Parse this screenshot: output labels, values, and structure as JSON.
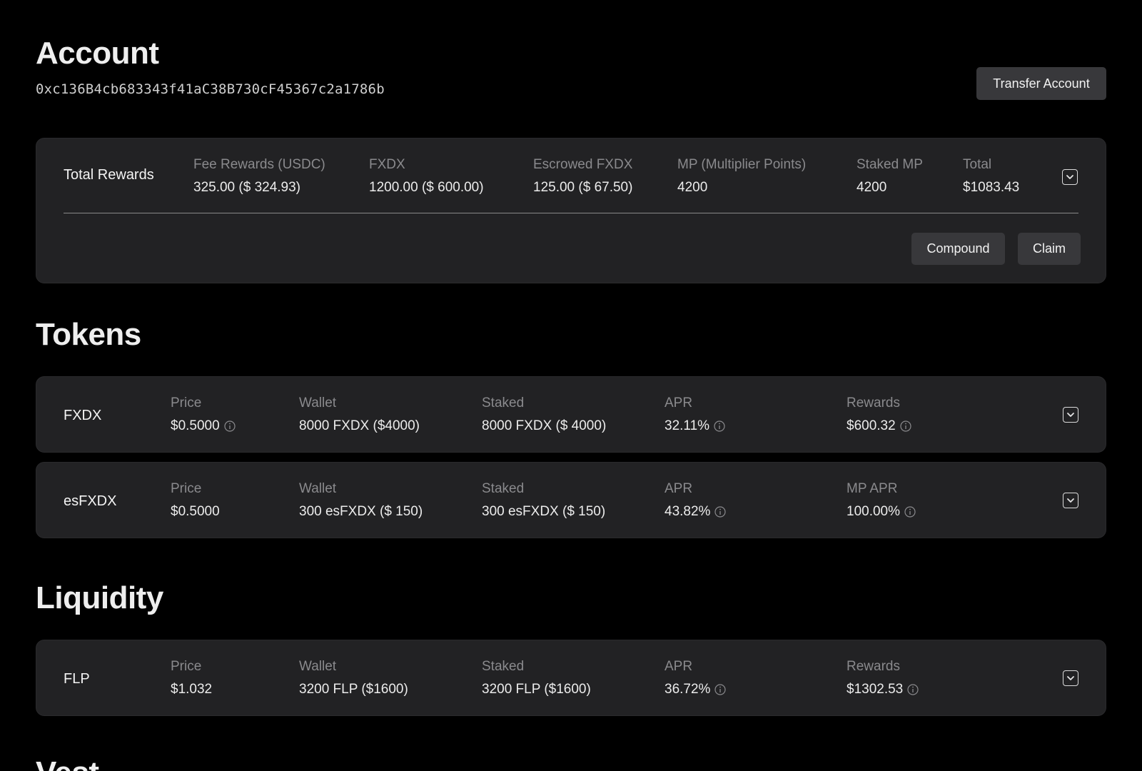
{
  "account": {
    "title": "Account",
    "address": "0xc136B4cb683343f41aC38B730cF45367c2a1786b",
    "transfer_label": "Transfer Account"
  },
  "rewards": {
    "title": "Total Rewards",
    "fee": {
      "label": "Fee Rewards (USDC)",
      "value": "325.00 ($ 324.93)"
    },
    "fxdx": {
      "label": "FXDX",
      "value": "1200.00 ($ 600.00)"
    },
    "escrowed": {
      "label": "Escrowed FXDX",
      "value": "125.00 ($ 67.50)"
    },
    "mp": {
      "label": "MP (Multiplier Points)",
      "value": "4200"
    },
    "staked_mp": {
      "label": "Staked MP",
      "value": "4200"
    },
    "total": {
      "label": "Total",
      "value": "$1083.43"
    },
    "compound_label": "Compound",
    "claim_label": "Claim"
  },
  "tokens": {
    "title": "Tokens",
    "rows": [
      {
        "name": "FXDX",
        "price_label": "Price",
        "price": "$0.5000",
        "wallet_label": "Wallet",
        "wallet": "8000 FXDX ($4000)",
        "staked_label": "Staked",
        "staked": "8000 FXDX ($ 4000)",
        "apr_label": "APR",
        "apr": "32.11%",
        "extra_label": "Rewards",
        "extra": "$600.32"
      },
      {
        "name": "esFXDX",
        "price_label": "Price",
        "price": "$0.5000",
        "wallet_label": "Wallet",
        "wallet": "300 esFXDX ($ 150)",
        "staked_label": "Staked",
        "staked": "300 esFXDX ($ 150)",
        "apr_label": "APR",
        "apr": "43.82%",
        "extra_label": "MP APR",
        "extra": "100.00%"
      }
    ]
  },
  "liquidity": {
    "title": "Liquidity",
    "rows": [
      {
        "name": "FLP",
        "price_label": "Price",
        "price": "$1.032",
        "wallet_label": "Wallet",
        "wallet": "3200 FLP ($1600)",
        "staked_label": "Staked",
        "staked": "3200 FLP ($1600)",
        "apr_label": "APR",
        "apr": "36.72%",
        "extra_label": "Rewards",
        "extra": "$1302.53"
      }
    ]
  },
  "next_section": {
    "title": "Vest"
  },
  "icons": {
    "info": "info-circle-icon",
    "expand": "chevron-down-square-icon"
  }
}
